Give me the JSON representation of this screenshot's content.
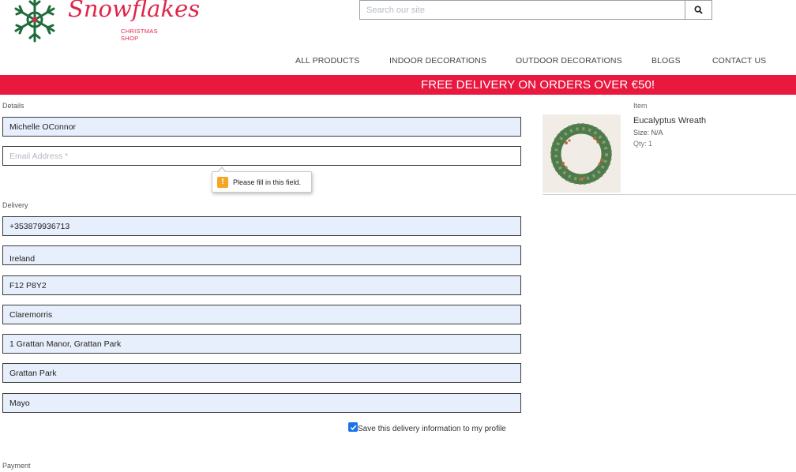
{
  "logo": {
    "brand": "Snowflakes",
    "tagline": "CHRISTMAS SHOP"
  },
  "search": {
    "placeholder": "Search our site",
    "button_icon": "search-icon"
  },
  "nav": [
    {
      "label": "ALL PRODUCTS"
    },
    {
      "label": "INDOOR DECORATIONS"
    },
    {
      "label": "OUTDOOR DECORATIONS"
    },
    {
      "label": "BLOGS"
    },
    {
      "label": "CONTACT US"
    }
  ],
  "banner": {
    "text": "FREE DELIVERY ON ORDERS OVER €50!",
    "color": "#e8183f"
  },
  "details": {
    "label": "Details",
    "name_value": "Michelle OConnor",
    "email_placeholder": "Email Address *",
    "validation_message": "Please fill in this field."
  },
  "delivery": {
    "label": "Delivery",
    "phone": "+353879936713",
    "country": "Ireland",
    "eircode": "F12 P8Y2",
    "town": "Claremorris",
    "address1": "1 Grattan Manor, Grattan Park",
    "address2": "Grattan Park",
    "county": "Mayo",
    "save_label": "Save this delivery information to my profile",
    "save_checked": true
  },
  "payment": {
    "label": "Payment"
  },
  "cart": {
    "column_label": "Item",
    "item_name": "Eucalyptus Wreath",
    "item_size": "Size: N/A",
    "item_qty": "Qty: 1"
  },
  "colors": {
    "brand_red": "#e0254a",
    "field_fill": "#e8effc",
    "checkbox_blue": "#1a73e8",
    "warning": "#f5a623"
  }
}
